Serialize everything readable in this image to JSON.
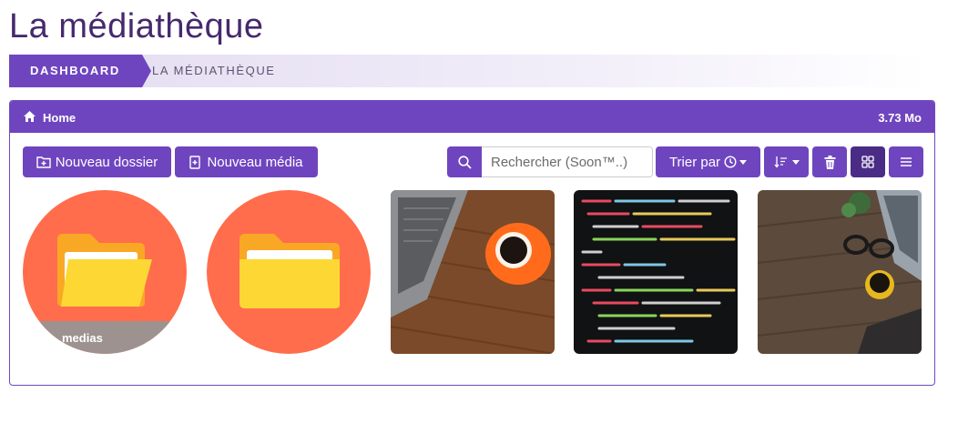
{
  "page": {
    "title": "La médiathèque"
  },
  "breadcrumb": {
    "items": [
      "DASHBOARD",
      "LA MÉDIATHÈQUE"
    ]
  },
  "panel": {
    "path_label": "Home",
    "size_label": "3.73 Mo"
  },
  "toolbar": {
    "new_folder_label": "Nouveau dossier",
    "new_media_label": "Nouveau média",
    "search_placeholder": "Rechercher (Soon™..)",
    "sort_label": "Trier par"
  },
  "items": [
    {
      "type": "folder",
      "name": "medias"
    },
    {
      "type": "folder",
      "name": ""
    },
    {
      "type": "image",
      "subject": "laptop and coffee cup on wooden desk"
    },
    {
      "type": "image",
      "subject": "code on dark screen"
    },
    {
      "type": "image",
      "subject": "desk with coffee, glasses and laptop"
    }
  ],
  "icons": [
    "home-icon",
    "folder-plus-icon",
    "file-plus-icon",
    "search-icon",
    "clock-icon",
    "sort-icon",
    "trash-icon",
    "grid-icon",
    "list-icon",
    "folder-icon",
    "menu-icon"
  ],
  "colors": {
    "primary": "#6f45bf",
    "title": "#46296e",
    "folder_bg": "#ff6d4c",
    "folder": "#fdd835"
  }
}
